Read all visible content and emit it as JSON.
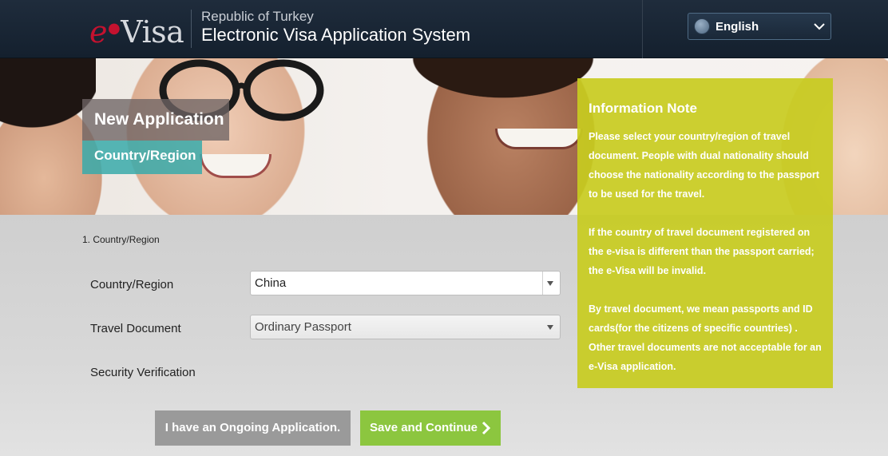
{
  "header": {
    "logo_e": "e",
    "logo_rest": "Visa",
    "title_small": "Republic of Turkey",
    "title_big": "Electronic Visa Application System",
    "language": "English"
  },
  "banner": {
    "heading": "New Application",
    "step": "Country/Region"
  },
  "form": {
    "section_label": "1. Country/Region",
    "country_label": "Country/Region",
    "country_value": "China",
    "document_label": "Travel Document",
    "document_value": "Ordinary Passport",
    "security_label": "Security Verification"
  },
  "buttons": {
    "ongoing": "I have an Ongoing Application.",
    "save": "Save and Continue"
  },
  "info": {
    "title": "Information Note",
    "p1": "Please select your country/region of travel document. People with dual nationality should choose the nationality according to the passport to be used for the travel.",
    "p2": "If the country of travel document registered on the e-visa is different than the passport carried; the e-Visa will be invalid.",
    "p3": "By travel document, we mean passports and ID cards(for the citizens of specific countries) . Other travel documents are not acceptable for an e-Visa application."
  },
  "colors": {
    "header_bg": "#1a2736",
    "logo_accent": "#c4122f",
    "info_bg": "#c8cc20",
    "save_btn": "#8cc63f",
    "ongoing_btn": "#9a9a9a",
    "step_tag": "#38aaaa"
  },
  "icons": [
    "globe-icon",
    "chevron-down-icon",
    "dropdown-arrow-icon",
    "arrow-right-icon"
  ]
}
